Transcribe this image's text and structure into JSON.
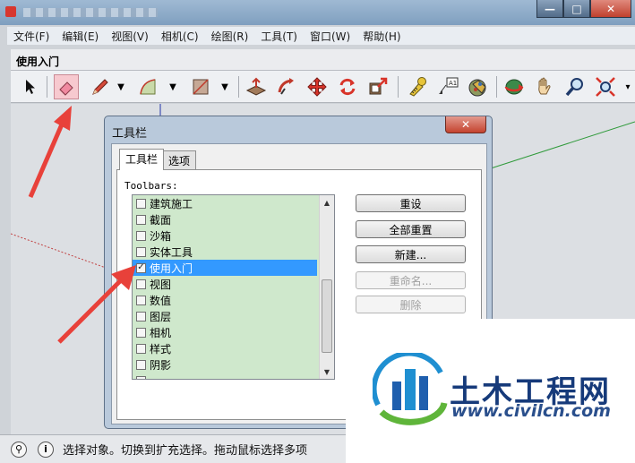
{
  "window": {
    "close_glyph": "✕",
    "maximize_glyph": "□",
    "minimize_glyph": "—"
  },
  "menu": {
    "items": [
      "文件(F)",
      "编辑(E)",
      "视图(V)",
      "相机(C)",
      "绘图(R)",
      "工具(T)",
      "窗口(W)",
      "帮助(H)"
    ]
  },
  "toolbar": {
    "title": "使用入门"
  },
  "dialog": {
    "title": "工具栏",
    "close_glyph": "✕",
    "tabs": [
      "工具栏",
      "选项"
    ],
    "toolbars_label": "Toolbars:",
    "list_items": [
      {
        "label": "建筑施工",
        "checked": false
      },
      {
        "label": "截面",
        "checked": false
      },
      {
        "label": "沙箱",
        "checked": false
      },
      {
        "label": "实体工具",
        "checked": false
      },
      {
        "label": "使用入门",
        "checked": true,
        "selected": true
      },
      {
        "label": "视图",
        "checked": false
      },
      {
        "label": "数值",
        "checked": false
      },
      {
        "label": "图层",
        "checked": false
      },
      {
        "label": "相机",
        "checked": false
      },
      {
        "label": "样式",
        "checked": false
      },
      {
        "label": "阴影",
        "checked": false
      },
      {
        "label": "",
        "checked": false
      }
    ],
    "buttons": {
      "reset": "重设",
      "reset_all": "全部重置",
      "new": "新建...",
      "rename": "重命名...",
      "delete": "删除"
    }
  },
  "status": {
    "text": "选择对象。切换到扩充选择。拖动鼠标选择多项"
  },
  "watermark": {
    "brand": "土木工程网",
    "url": "www.civilcn.com"
  },
  "colors": {
    "annotation_arrow": "#e8413a",
    "selection": "#3399ff",
    "list_bg": "#cfe8cc",
    "brand_blue": "#163a7a"
  }
}
